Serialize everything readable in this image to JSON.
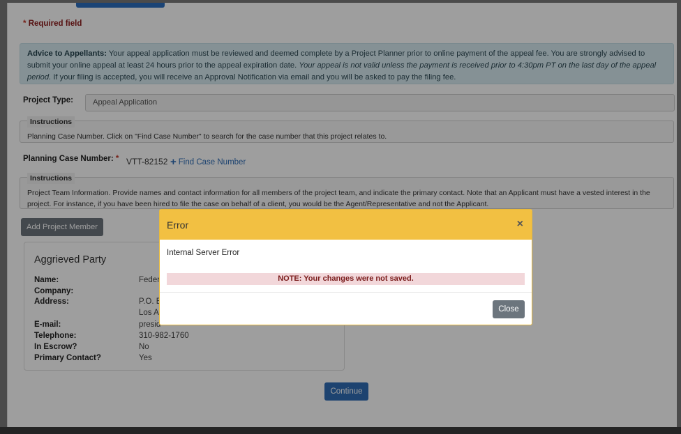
{
  "required": {
    "star": "*",
    "label": "Required field"
  },
  "advice": {
    "heading": "Advice to Appellants:",
    "text1": " Your appeal application must be reviewed and deemed complete by a Project Planner prior to online payment of the appeal fee. You are strongly advised to submit your online appeal at least 24 hours prior to the appeal expiration date. ",
    "italic": "Your appeal is not valid unless the payment is received prior to 4:30pm PT on the last day of the appeal period.",
    "text2": " If your filing is accepted, you will receive an Approval Notification via email and you will be asked to pay the filing fee."
  },
  "project_type": {
    "label": "Project Type:",
    "value": "Appeal Application"
  },
  "instructions1": {
    "legend": "Instructions",
    "text": "Planning Case Number. Click on \"Find Case Number\" to search for the case number that this project relates to."
  },
  "case_number": {
    "label": "Planning Case Number:",
    "star": "*",
    "value": "VTT-82152",
    "find_label": "Find Case Number",
    "find_icon": "plus-icon"
  },
  "instructions2": {
    "legend": "Instructions",
    "text": "Project Team Information. Provide names and contact information for all members of the project team, and indicate the primary contact. Note that an Applicant must have a vested interest in the project. For instance, if you have been hired to file the case on behalf of a client, you would be the Agent/Representative and not the Applicant."
  },
  "add_member_label": "Add Project Member",
  "party": {
    "title": "Aggrieved Party",
    "rows": [
      {
        "key": "Name:",
        "value": "Federa"
      },
      {
        "key": "Company:",
        "value": ""
      },
      {
        "key": "Address:",
        "value": "P.O. Bo"
      },
      {
        "key": "",
        "value": "Los An"
      },
      {
        "key": "E-mail:",
        "value": "presid"
      },
      {
        "key": "Telephone:",
        "value": "310-982-1760"
      },
      {
        "key": "In Escrow?",
        "value": "No"
      },
      {
        "key": "Primary Contact?",
        "value": "Yes"
      }
    ]
  },
  "continue_label": "Continue",
  "modal": {
    "title": "Error",
    "close_x": "×",
    "message": "Internal Server Error",
    "note": "NOTE: Your changes were not saved.",
    "close_label": "Close"
  },
  "colors": {
    "header": "#f2c042",
    "primary": "#2f6db5",
    "secondary": "#6c757d",
    "required": "#8b1a1a"
  }
}
